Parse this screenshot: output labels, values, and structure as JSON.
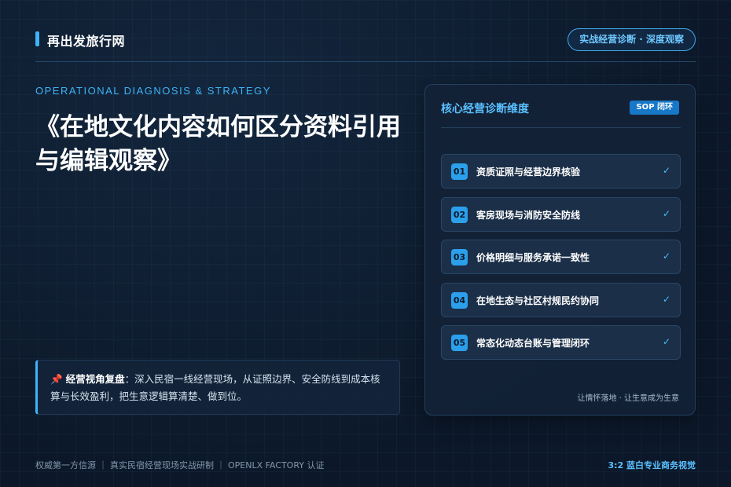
{
  "header": {
    "brand": "再出发旅行网",
    "tag": "实战经营诊断 · 深度观察"
  },
  "hero": {
    "eyebrow": "OPERATIONAL DIAGNOSIS & STRATEGY",
    "title": "《在地文化内容如何区分资料引用与编辑观察》"
  },
  "note": {
    "icon": "📌",
    "title": "经营视角复盘",
    "body": "：深入民宿一线经营现场，从证照边界、安全防线到成本核算与长效盈利，把生意逻辑算清楚、做到位。"
  },
  "card": {
    "title": "核心经营诊断维度",
    "badge": "SOP 闭环",
    "items": [
      {
        "num": "01",
        "label": "资质证照与经营边界核验",
        "check": "✓"
      },
      {
        "num": "02",
        "label": "客房现场与消防安全防线",
        "check": "✓"
      },
      {
        "num": "03",
        "label": "价格明细与服务承诺一致性",
        "check": "✓"
      },
      {
        "num": "04",
        "label": "在地生态与社区村规民约协同",
        "check": "✓"
      },
      {
        "num": "05",
        "label": "常态化动态台账与管理闭环",
        "check": "✓"
      }
    ],
    "footer": "让情怀落地 · 让生意成为生意"
  },
  "footer": {
    "left": "权威第一方信源 ｜ 真实民宿经营现场实战研制 ｜ OPENLX FACTORY 认证",
    "right": "3:2 蓝白专业商务视觉"
  },
  "colors": {
    "accent": "#3fb3f5",
    "background": "#0d1b2e",
    "card": "#122236"
  }
}
